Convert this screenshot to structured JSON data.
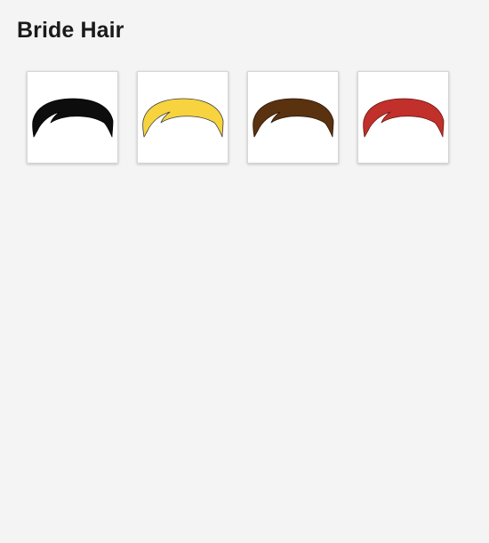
{
  "section": {
    "title": "Bride Hair"
  },
  "hair_options": [
    {
      "name": "black-hair",
      "color": "#0d0d0d",
      "outline": "#000000"
    },
    {
      "name": "blonde-hair",
      "color": "#f7d33f",
      "outline": "#3a3a3a"
    },
    {
      "name": "brown-hair",
      "color": "#5a3210",
      "outline": "#2a1505"
    },
    {
      "name": "red-hair",
      "color": "#c1302b",
      "outline": "#6a1412"
    }
  ]
}
